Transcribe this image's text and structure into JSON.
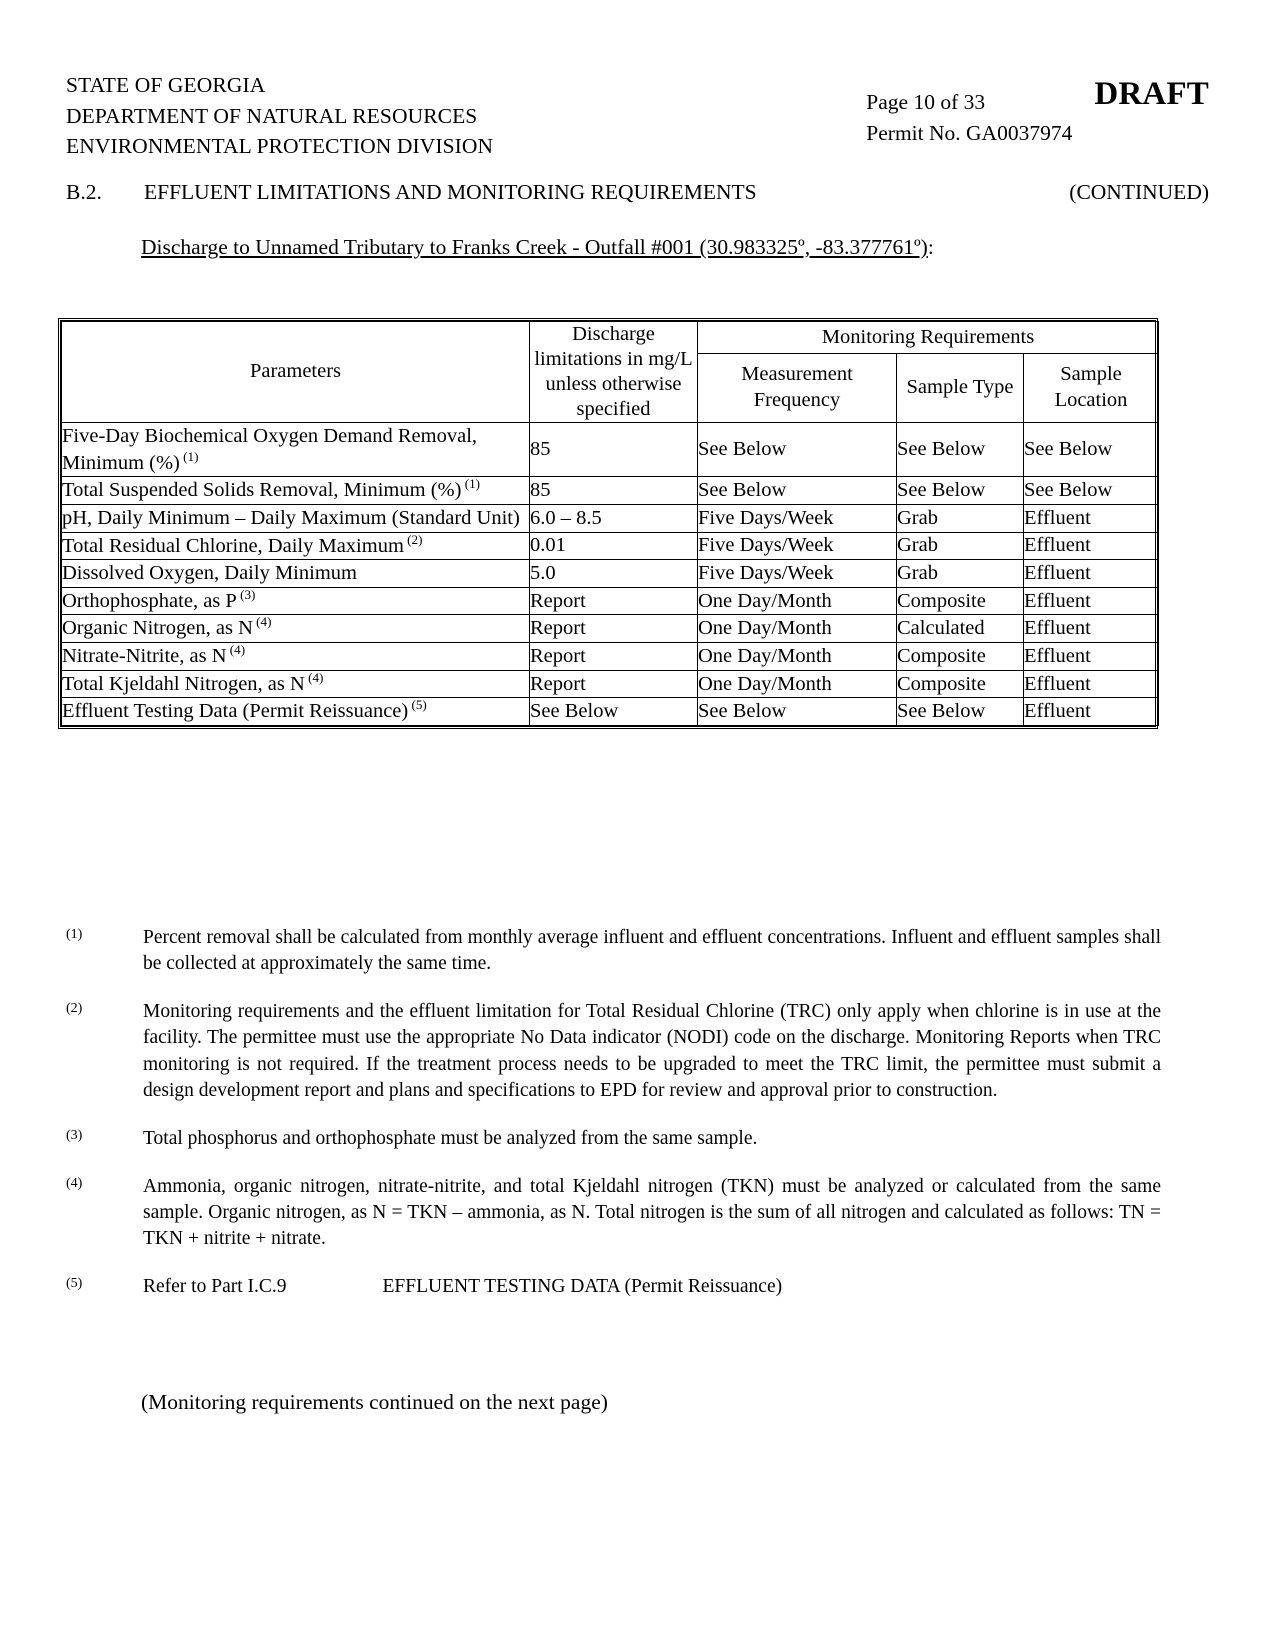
{
  "header": {
    "agency_lines": [
      "STATE OF GEORGIA",
      "DEPARTMENT OF NATURAL RESOURCES",
      "ENVIRONMENTAL PROTECTION DIVISION"
    ],
    "page_label": "Page 10 of 33",
    "permit_label": "Permit No. GA0037974",
    "draft_stamp": "DRAFT"
  },
  "section": {
    "number": "B.2.",
    "title": "EFFLUENT LIMITATIONS AND MONITORING REQUIREMENTS",
    "continued": "(CONTINUED)",
    "subtitle_underlined": "Discharge to Unnamed Tributary to Franks Creek - Outfall #001 (30.983325º, -83.377761º)",
    "subtitle_suffix": ":"
  },
  "table": {
    "headers": {
      "parameters": "Parameters",
      "discharge_limitations": "Discharge limitations in mg/L unless otherwise specified",
      "monitoring_requirements": "Monitoring Requirements",
      "measurement_frequency": "Measurement Frequency",
      "sample_type": "Sample Type",
      "sample_location": "Sample Location"
    },
    "rows": [
      {
        "parameter": "Five-Day Biochemical Oxygen Demand Removal, Minimum (%)",
        "footnote": "(1)",
        "limit": "85",
        "frequency": "See Below",
        "sample_type": "See Below",
        "sample_location": "See Below"
      },
      {
        "parameter": "Total Suspended Solids Removal, Minimum (%)",
        "footnote": "(1)",
        "limit": "85",
        "frequency": "See Below",
        "sample_type": "See Below",
        "sample_location": "See Below"
      },
      {
        "parameter": "pH, Daily Minimum – Daily Maximum (Standard Unit)",
        "footnote": "",
        "limit": "6.0 – 8.5",
        "frequency": "Five Days/Week",
        "sample_type": "Grab",
        "sample_location": "Effluent"
      },
      {
        "parameter": "Total Residual Chlorine, Daily Maximum",
        "footnote": "(2)",
        "limit": "0.01",
        "frequency": "Five Days/Week",
        "sample_type": "Grab",
        "sample_location": "Effluent"
      },
      {
        "parameter": "Dissolved Oxygen, Daily Minimum",
        "footnote": "",
        "limit": "5.0",
        "frequency": "Five Days/Week",
        "sample_type": "Grab",
        "sample_location": "Effluent"
      },
      {
        "parameter": "Orthophosphate, as P",
        "footnote": "(3)",
        "limit": "Report",
        "frequency": "One Day/Month",
        "sample_type": "Composite",
        "sample_location": "Effluent"
      },
      {
        "parameter": "Organic Nitrogen, as N",
        "footnote": "(4)",
        "limit": "Report",
        "frequency": "One Day/Month",
        "sample_type": "Calculated",
        "sample_location": "Effluent"
      },
      {
        "parameter": "Nitrate-Nitrite, as N",
        "footnote": "(4)",
        "limit": "Report",
        "frequency": "One Day/Month",
        "sample_type": "Composite",
        "sample_location": "Effluent"
      },
      {
        "parameter": "Total Kjeldahl Nitrogen, as N",
        "footnote": "(4)",
        "limit": "Report",
        "frequency": "One Day/Month",
        "sample_type": "Composite",
        "sample_location": "Effluent"
      },
      {
        "parameter": "Effluent Testing Data (Permit Reissuance)",
        "footnote": "(5)",
        "limit": "See Below",
        "frequency": "See Below",
        "sample_type": "See Below",
        "sample_location": "Effluent"
      }
    ]
  },
  "footnotes": [
    {
      "mark": "(1)",
      "text": "Percent removal shall be calculated from monthly average influent and effluent concentrations.  Influent and effluent samples shall be collected at approximately the same time."
    },
    {
      "mark": "(2)",
      "text": "Monitoring requirements and the effluent limitation for Total Residual Chlorine (TRC) only apply when chlorine is in use at the facility. The permittee must use the appropriate No Data indicator (NODI) code on the discharge. Monitoring Reports when TRC monitoring is not required.  If the treatment process needs to be upgraded to meet the TRC limit, the permittee must submit a design development report and plans and specifications to EPD for review and approval prior to construction."
    },
    {
      "mark": "(3)",
      "text": "Total phosphorus and orthophosphate must be analyzed from the same sample."
    },
    {
      "mark": "(4)",
      "text": "Ammonia, organic nitrogen, nitrate-nitrite, and total Kjeldahl nitrogen (TKN) must be analyzed or calculated from the same sample. Organic nitrogen, as N = TKN – ammonia, as N. Total nitrogen is the sum of all nitrogen and calculated as follows: TN = TKN + nitrite + nitrate."
    },
    {
      "mark": "(5)",
      "text_part1": "Refer to Part I.C.9",
      "text_part2": "EFFLUENT TESTING DATA (Permit Reissuance)"
    }
  ],
  "footer_note": "(Monitoring requirements continued on the next page)"
}
